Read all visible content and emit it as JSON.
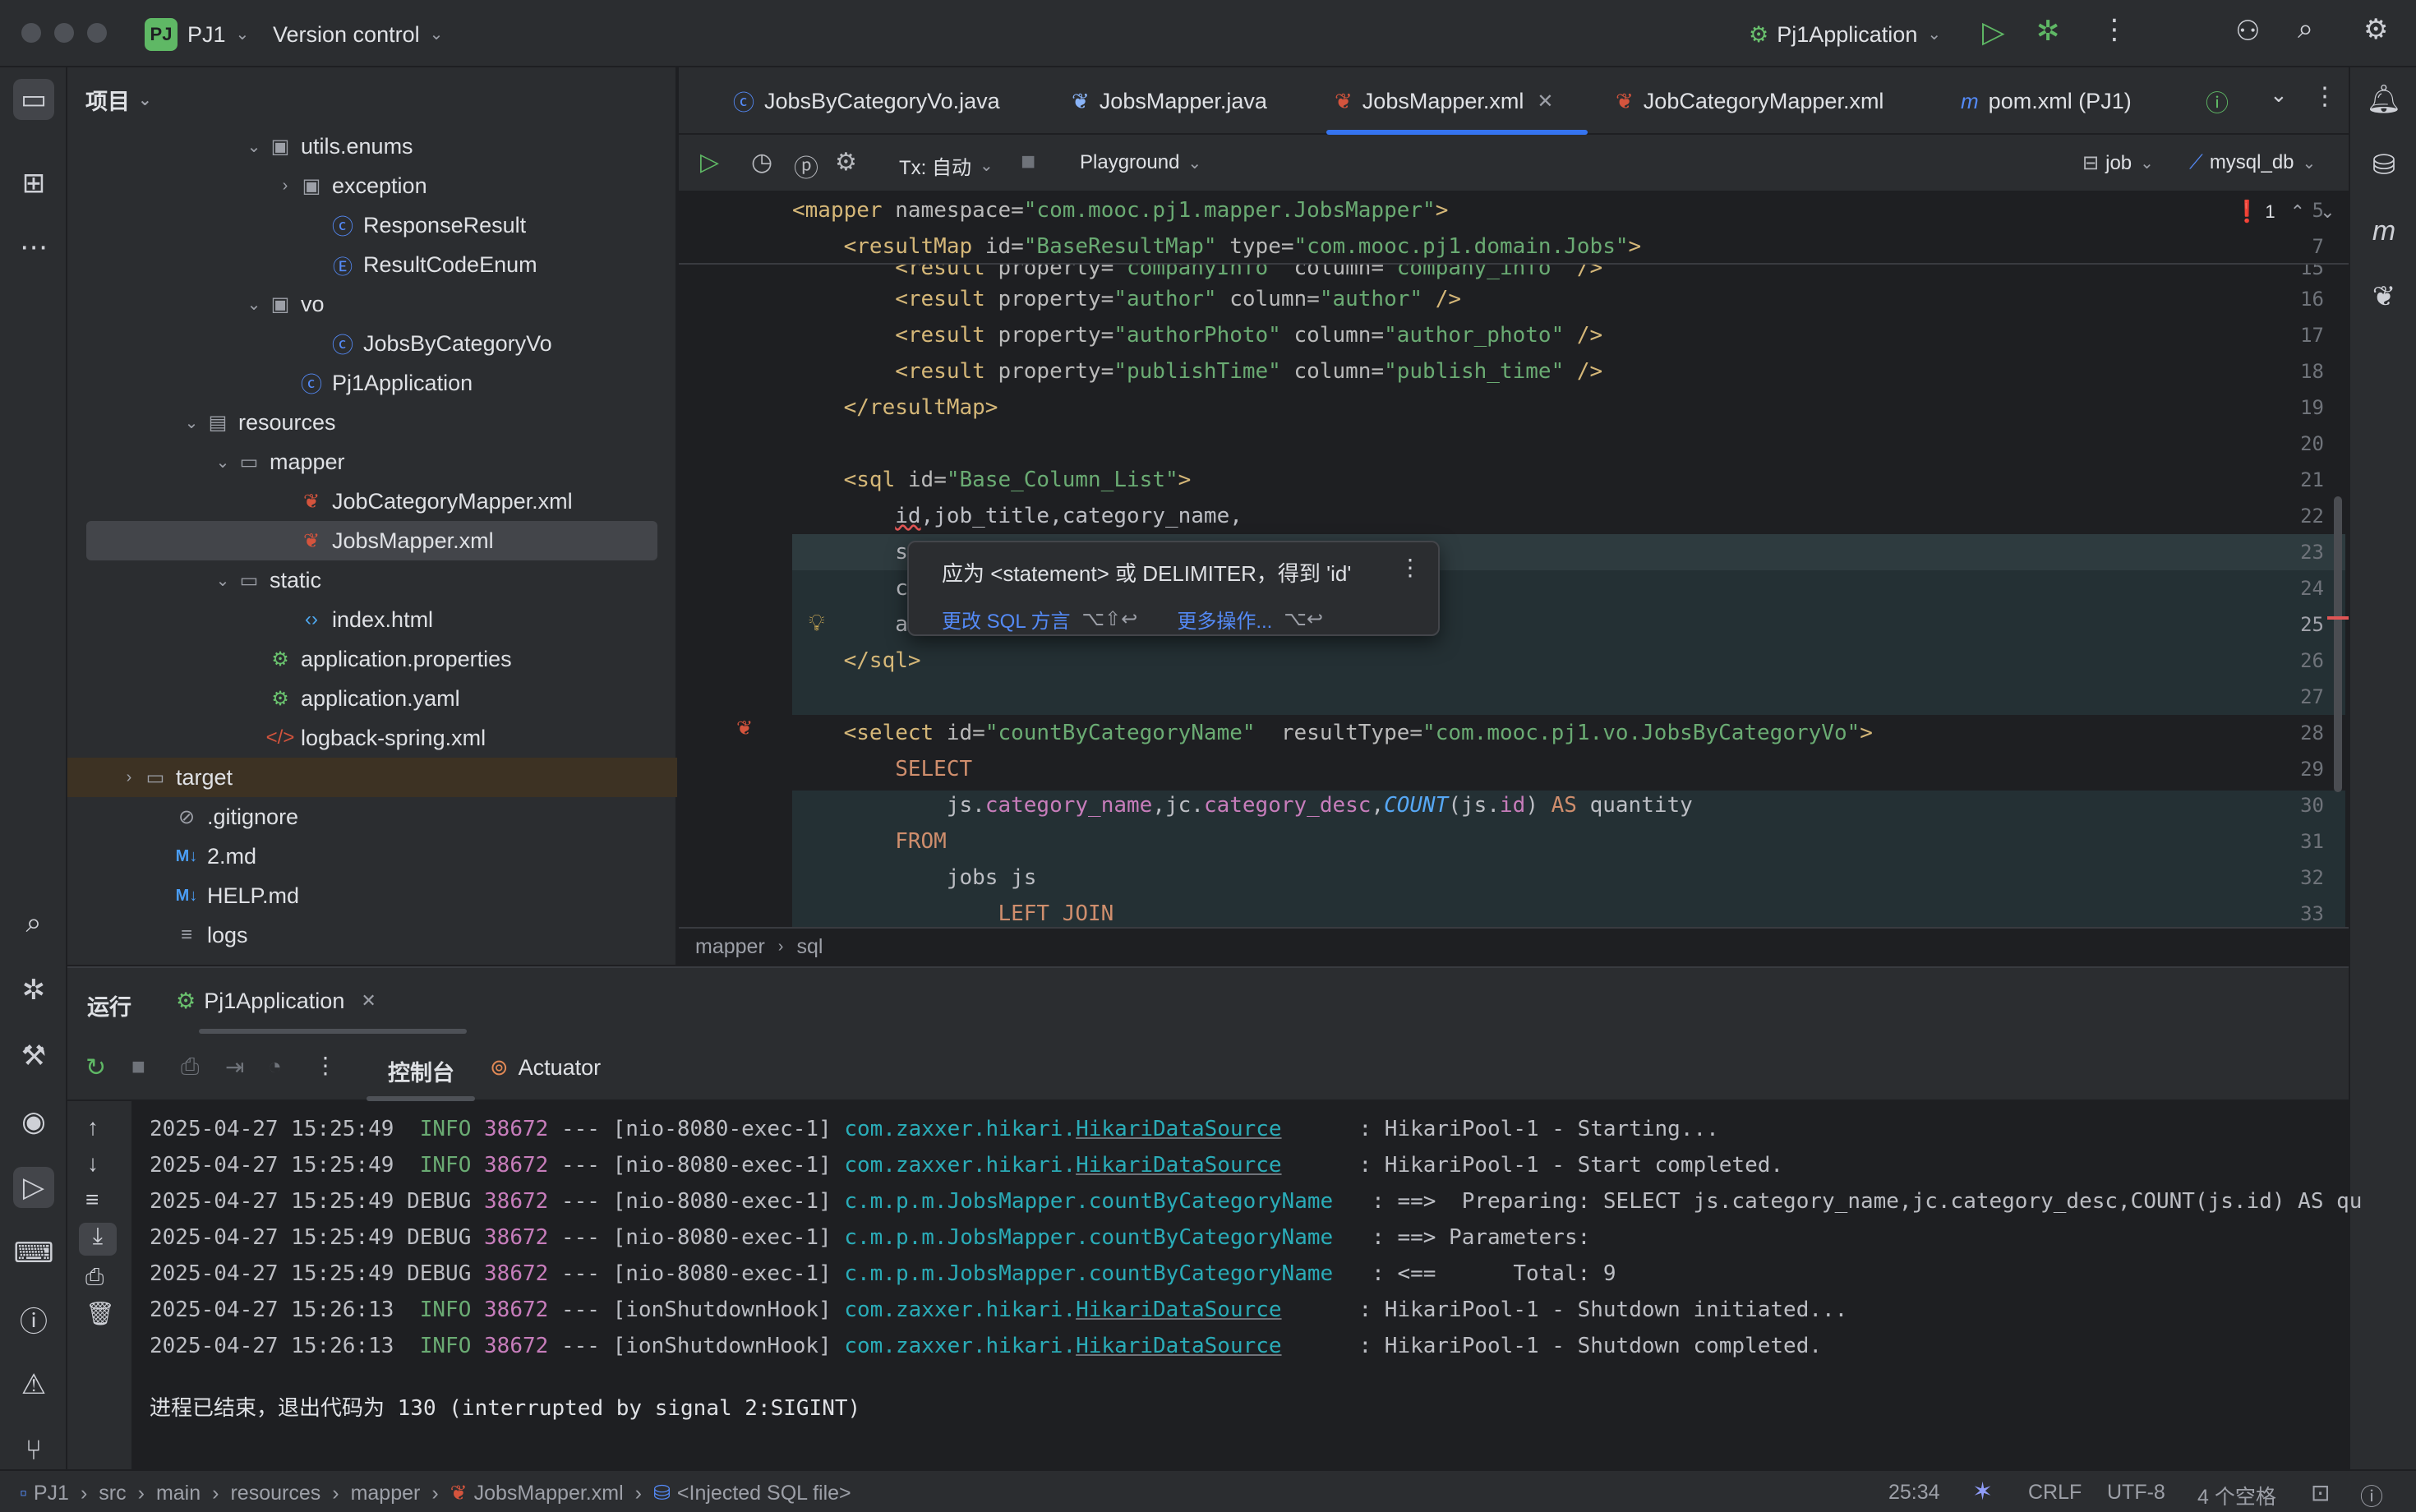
{
  "titlebar": {
    "project_badge": "PJ",
    "project_name": "PJ1",
    "vcs": "Version control",
    "run_config": "Pj1Application"
  },
  "project_panel": {
    "title": "项目",
    "items": [
      {
        "label": "utils.enums",
        "icon": "package-icon",
        "depth": 5,
        "expanded": true
      },
      {
        "label": "exception",
        "icon": "package-icon",
        "depth": 6,
        "expanded": false
      },
      {
        "label": "ResponseResult",
        "icon": "class-icon",
        "depth": 7
      },
      {
        "label": "ResultCodeEnum",
        "icon": "enum-icon",
        "depth": 7
      },
      {
        "label": "vo",
        "icon": "package-icon",
        "depth": 5,
        "expanded": true
      },
      {
        "label": "JobsByCategoryVo",
        "icon": "class-icon",
        "depth": 7
      },
      {
        "label": "Pj1Application",
        "icon": "spring-class-icon",
        "depth": 6
      },
      {
        "label": "resources",
        "icon": "resources-folder-icon",
        "depth": 3,
        "expanded": true
      },
      {
        "label": "mapper",
        "icon": "folder-icon",
        "depth": 4,
        "expanded": true
      },
      {
        "label": "JobCategoryMapper.xml",
        "icon": "mybatis-xml-icon",
        "depth": 6
      },
      {
        "label": "JobsMapper.xml",
        "icon": "mybatis-xml-icon",
        "depth": 6,
        "selected": true
      },
      {
        "label": "static",
        "icon": "folder-icon",
        "depth": 4,
        "expanded": true
      },
      {
        "label": "index.html",
        "icon": "html-icon",
        "depth": 6
      },
      {
        "label": "application.properties",
        "icon": "spring-config-icon",
        "depth": 5
      },
      {
        "label": "application.yaml",
        "icon": "spring-config-icon",
        "depth": 5
      },
      {
        "label": "logback-spring.xml",
        "icon": "xml-icon",
        "depth": 5
      },
      {
        "label": "target",
        "icon": "folder-icon",
        "depth": 1,
        "expanded": false
      },
      {
        "label": ".gitignore",
        "icon": "ignore-icon",
        "depth": 2
      },
      {
        "label": "2.md",
        "icon": "markdown-icon",
        "depth": 2
      },
      {
        "label": "HELP.md",
        "icon": "markdown-icon",
        "depth": 2
      },
      {
        "label": "logs",
        "icon": "text-file-icon",
        "depth": 2
      }
    ]
  },
  "tabs": [
    {
      "label": "JobsByCategoryVo.java",
      "icon": "class-icon"
    },
    {
      "label": "JobsMapper.java",
      "icon": "mybatis-java-icon"
    },
    {
      "label": "JobsMapper.xml",
      "icon": "mybatis-xml-icon",
      "active": true
    },
    {
      "label": "JobCategoryMapper.xml",
      "icon": "mybatis-xml-icon"
    },
    {
      "label": "pom.xml (PJ1)",
      "icon": "maven-icon"
    }
  ],
  "editor_toolbar": {
    "tx": "Tx: 自动",
    "playground": "Playground",
    "schema": "job",
    "datasource": "mysql_db",
    "problems": "1"
  },
  "editor": {
    "sticky_lines": [
      {
        "n": "5",
        "text": "<mapper namespace=\"com.mooc.pj1.mapper.JobsMapper\">"
      },
      {
        "n": "7",
        "text": "    <resultMap id=\"BaseResultMap\" type=\"com.mooc.pj1.domain.Jobs\">"
      }
    ],
    "line_numbers": [
      "15",
      "16",
      "17",
      "18",
      "19",
      "20",
      "21",
      "22",
      "23",
      "24",
      "25",
      "26",
      "27",
      "28",
      "29",
      "30",
      "31",
      "32",
      "33"
    ],
    "current_line": "25",
    "breadcrumb": [
      "mapper",
      "sql"
    ]
  },
  "popup": {
    "message": "应为 <statement> 或 DELIMITER，得到 'id'",
    "action1": "更改 SQL 方言",
    "action1_key": "⌥⇧↩",
    "action2": "更多操作...",
    "action2_key": "⌥↩"
  },
  "run_panel": {
    "title": "运行",
    "config_tab": "Pj1Application",
    "console_tab": "控制台",
    "actuator_tab": "Actuator",
    "logs": [
      {
        "ts": "2025-04-27 15:25:49",
        "level": " INFO",
        "pid": "38672",
        "thread": "[nio-8080-exec-1]",
        "cls_pre": "com.zaxxer.hikari.",
        "cls_u": "HikariDataSource",
        "pad": "      ",
        "msg": ": HikariPool-1 - Starting..."
      },
      {
        "ts": "2025-04-27 15:25:49",
        "level": " INFO",
        "pid": "38672",
        "thread": "[nio-8080-exec-1]",
        "cls_pre": "com.zaxxer.hikari.",
        "cls_u": "HikariDataSource",
        "pad": "      ",
        "msg": ": HikariPool-1 - Start completed."
      },
      {
        "ts": "2025-04-27 15:25:49",
        "level": "DEBUG",
        "pid": "38672",
        "thread": "[nio-8080-exec-1]",
        "cls_pre": "c.m.p.m.JobsMapper.countByCategoryName",
        "cls_u": "",
        "pad": "   ",
        "msg": ": ==>  Preparing: SELECT js.category_name,jc.category_desc,COUNT(js.id) AS qu"
      },
      {
        "ts": "2025-04-27 15:25:49",
        "level": "DEBUG",
        "pid": "38672",
        "thread": "[nio-8080-exec-1]",
        "cls_pre": "c.m.p.m.JobsMapper.countByCategoryName",
        "cls_u": "",
        "pad": "   ",
        "msg": ": ==> Parameters: "
      },
      {
        "ts": "2025-04-27 15:25:49",
        "level": "DEBUG",
        "pid": "38672",
        "thread": "[nio-8080-exec-1]",
        "cls_pre": "c.m.p.m.JobsMapper.countByCategoryName",
        "cls_u": "",
        "pad": "   ",
        "msg": ": <==      Total: 9"
      },
      {
        "ts": "2025-04-27 15:26:13",
        "level": " INFO",
        "pid": "38672",
        "thread": "[ionShutdownHook]",
        "cls_pre": "com.zaxxer.hikari.",
        "cls_u": "HikariDataSource",
        "pad": "      ",
        "msg": ": HikariPool-1 - Shutdown initiated..."
      },
      {
        "ts": "2025-04-27 15:26:13",
        "level": " INFO",
        "pid": "38672",
        "thread": "[ionShutdownHook]",
        "cls_pre": "com.zaxxer.hikari.",
        "cls_u": "HikariDataSource",
        "pad": "      ",
        "msg": ": HikariPool-1 - Shutdown completed."
      }
    ],
    "exit_message": "进程已结束，退出代码为 130 (interrupted by signal 2:SIGINT)"
  },
  "statusbar": {
    "path": [
      "PJ1",
      "src",
      "main",
      "resources",
      "mapper",
      "JobsMapper.xml",
      "<Injected SQL file>"
    ],
    "position": "25:34",
    "line_sep": "CRLF",
    "encoding": "UTF-8",
    "indent": "4 个空格"
  },
  "colors": {
    "accent": "#3574f0",
    "bg": "#1e1f22",
    "panel": "#2b2d30"
  }
}
